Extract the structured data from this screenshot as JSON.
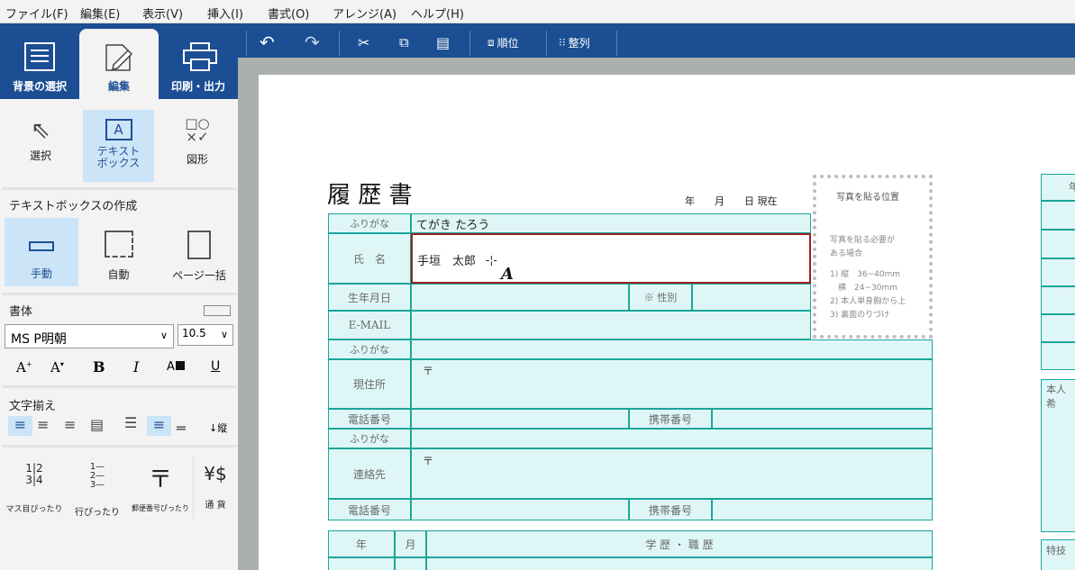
{
  "menu": [
    "ファイル(F)",
    "編集(E)",
    "表示(V)",
    "挿入(I)",
    "書式(O)",
    "アレンジ(A)",
    "ヘルプ(H)"
  ],
  "tabs": {
    "background": "背景の選択",
    "edit": "編集",
    "print": "印刷・出力"
  },
  "toolbar": {
    "order": "順位",
    "align": "整列"
  },
  "tools": {
    "select": "選択",
    "textbox": "テキスト\nボックス",
    "shape": "図形"
  },
  "textbox_create": {
    "title": "テキストボックスの作成",
    "manual": "手動",
    "auto": "自動",
    "page_all": "ページ一括"
  },
  "font": {
    "title": "書体",
    "name": "MS P明朝",
    "size": "10.5",
    "bold": "B",
    "italic": "I",
    "underline": "U",
    "grow": "A",
    "shrink": "A"
  },
  "align": {
    "title": "文字揃え",
    "vertical": "↓縦"
  },
  "bottom_tools": {
    "grid": "マス目ぴったり",
    "line": "行ぴったり",
    "postal": "郵便番号ぴったり",
    "currency": "通 貨"
  },
  "form": {
    "title": "履 歴 書",
    "date": "年　　月　　日 現在",
    "furigana_label": "ふりがな",
    "furigana_value": "てがき  たろう",
    "name_label": "氏　名",
    "name_value": "手垣　太郎",
    "birth_label": "生年月日",
    "gender_label": "※ 性別",
    "email_label": "E-MAIL",
    "address_label": "現住所",
    "postal_mark": "〒",
    "phone_label": "電話番号",
    "mobile_label": "携帯番号",
    "contact_label": "連絡先",
    "year_label": "年",
    "month_label": "月",
    "history_label": "学 歴 ・ 職 歴",
    "photo_title": "写真を貼る位置",
    "photo_lines": [
      "写真を貼る必要が",
      "ある場合",
      "",
      "1) 縦　36~40mm",
      "　横　24~30mm",
      "2) 本人単身胸から上",
      "3) 裏面のりづけ"
    ],
    "right_1": "年",
    "right_2": "本人希",
    "right_3": "特技"
  },
  "colors": {
    "brand": "#1c4e94",
    "active": "#cce4f7",
    "cell_bg": "#dff6f7",
    "cell_border": "#1ba69b",
    "selected_border": "#9b2020"
  }
}
